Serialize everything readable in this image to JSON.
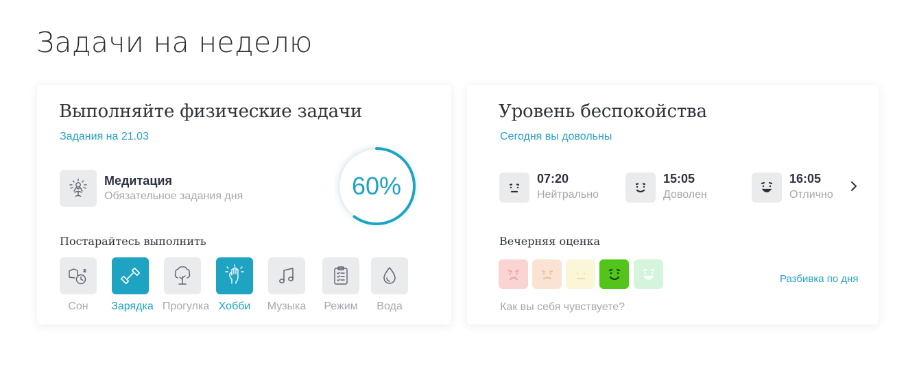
{
  "page": {
    "title": "Задачи на неделю"
  },
  "physical": {
    "title": "Выполняйте физические задачи",
    "subtitle": "Задания на 21.03",
    "main_task": {
      "name": "Медитация",
      "description": "Обязательное задания дня",
      "icon": "meditation-icon"
    },
    "progress": {
      "value": 0.6,
      "label": "60%",
      "color": "#1fa3c3"
    },
    "try_label": "Постарайтесь выполнить",
    "activities": [
      {
        "label": "Сон",
        "icon": "sleep-icon",
        "active": false
      },
      {
        "label": "Зарядка",
        "icon": "dumbbell-icon",
        "active": true
      },
      {
        "label": "Прогулка",
        "icon": "tree-icon",
        "active": false
      },
      {
        "label": "Хобби",
        "icon": "hand-icon",
        "active": true
      },
      {
        "label": "Музыка",
        "icon": "music-note-icon",
        "active": false
      },
      {
        "label": "Режим",
        "icon": "clipboard-icon",
        "active": false
      },
      {
        "label": "Вода",
        "icon": "water-drop-icon",
        "active": false
      }
    ]
  },
  "anxiety": {
    "title": "Уровень беспокойства",
    "subtitle": "Сегодня вы довольны",
    "moods": [
      {
        "time": "07:20",
        "state": "Нейтрально",
        "icon": "neutral-face-icon"
      },
      {
        "time": "15:05",
        "state": "Доволен",
        "icon": "content-face-icon"
      },
      {
        "time": "16:05",
        "state": "Отлично",
        "icon": "happy-face-icon"
      }
    ],
    "evening_label": "Вечерняя оценка",
    "rating": {
      "options": [
        {
          "icon": "sad-face-icon",
          "color": "#f9d4d2"
        },
        {
          "icon": "unhappy-face-icon",
          "color": "#fbe3d3"
        },
        {
          "icon": "neutral-face-icon",
          "color": "#fbf6d8"
        },
        {
          "icon": "happy-face-icon",
          "color": "#52c41a"
        },
        {
          "icon": "very-happy-face-icon",
          "color": "#d4f5dc"
        }
      ],
      "selected": 4
    },
    "breakdown_link": "Разбивка по дня",
    "question": "Как вы себя чувствуете?"
  },
  "colors": {
    "accent": "#1fa3c3",
    "muted": "#a4a8b0",
    "tile": "#eaebed"
  }
}
